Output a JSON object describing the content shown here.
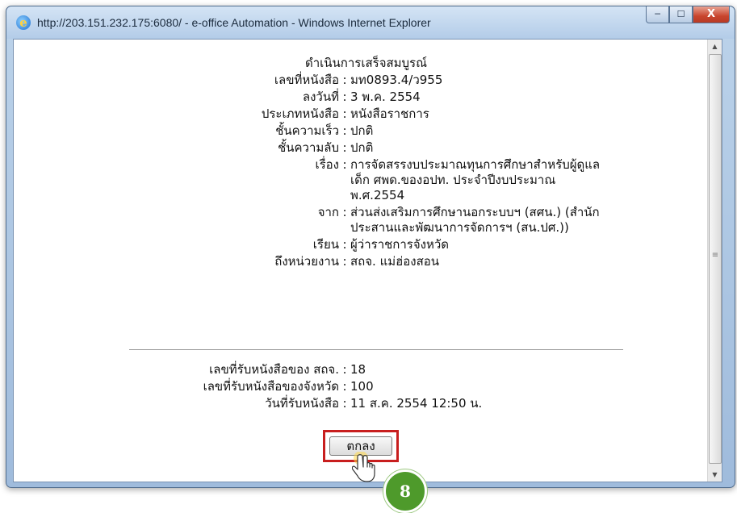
{
  "window": {
    "title": "http://203.151.232.175:6080/ - e-office Automation - Windows Internet Explorer",
    "buttons": {
      "minimize": "─",
      "maximize": "☐",
      "close": "X"
    }
  },
  "document": {
    "heading": "ดำเนินการเสร็จสมบูรณ์",
    "fields": [
      {
        "label": "เลขที่หนังสือ",
        "sep": ":",
        "value": "มท0893.4/ว955"
      },
      {
        "label": "ลงวันที่",
        "sep": ":",
        "value": "3 พ.ค. 2554"
      },
      {
        "label": "ประเภทหนังสือ",
        "sep": ":",
        "value": "หนังสือราชการ"
      },
      {
        "label": "ชั้นความเร็ว",
        "sep": ":",
        "value": "ปกติ"
      },
      {
        "label": "ชั้นความลับ",
        "sep": ":",
        "value": "ปกติ"
      },
      {
        "label": "เรื่อง",
        "sep": ":",
        "value": "การจัดสรรงบประมาณทุนการศึกษาสำหรับผู้ดูแลเด็ก ศพด.ของอปท. ประจำปีงบประมาณ พ.ศ.2554"
      },
      {
        "label": "จาก",
        "sep": ":",
        "value": "ส่วนส่งเสริมการศึกษานอกระบบฯ (สศน.) (สำนักประสานและพัฒนาการจัดการฯ (สน.ปศ.))"
      },
      {
        "label": "เรียน",
        "sep": ":",
        "value": "ผู้ว่าราชการจังหวัด"
      },
      {
        "label": "ถึงหน่วยงาน",
        "sep": ":",
        "value": "สถจ. แม่ฮ่องสอน"
      }
    ],
    "receipt": [
      {
        "label": "เลขที่รับหนังสือของ สถจ.",
        "sep": ":",
        "value": "18"
      },
      {
        "label": "เลขที่รับหนังสือของจังหวัด",
        "sep": ":",
        "value": "100"
      },
      {
        "label": "วันที่รับหนังสือ",
        "sep": ":",
        "value": "11 ส.ค. 2554 12:50 น."
      }
    ],
    "ok_button": "ตกลง"
  },
  "annotation": {
    "step_number": "8",
    "highlight_color": "#c81e1e",
    "badge_color": "#4e9a2b"
  },
  "icons": [
    "ie-icon",
    "hand-cursor-icon",
    "scroll-up-arrow-icon",
    "scroll-down-arrow-icon"
  ]
}
